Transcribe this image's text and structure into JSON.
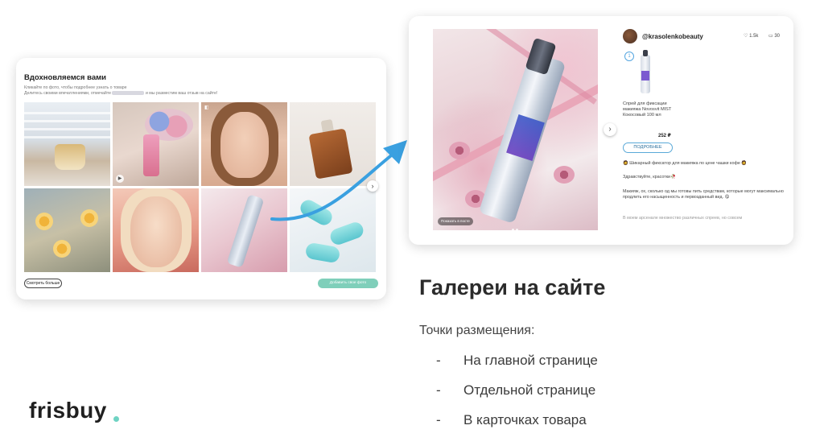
{
  "gallery": {
    "title": "Вдохновляемся вами",
    "subtitle_line1": "Кликайте по фото, чтобы подробнее узнать о товаре",
    "subtitle_line2_a": "Делитесь своими впечатлениями, отмечайте",
    "subtitle_line2_b": "и мы разместим ваш отзыв на сайте!",
    "see_more_label": "Смотреть больше",
    "add_photo_label": "Добавить свое фото",
    "next_arrow": "›"
  },
  "detail": {
    "username": "@krasolenkobeauty",
    "likes": "1.5k",
    "comments": "30",
    "tag_number": "1",
    "product_name": "Спрей для фиксации макияжа Novosvit MIST Кокосовый 100 мл",
    "price": "252 ₽",
    "more_label": "ПОДРОБНЕЕ",
    "post_line1": "🧔 Шикарный фиксатор для макияжа по цене чашки кофе 🧔",
    "post_line2": "Здравствуйте, красотки🥀",
    "post_line3": "Макияж, ох, сколько од мы готовы пить средствам, которые могут максимально продлить его насыщенность и первозданный вид. 😋",
    "post_line4": "В моем арсенале множество различных спреев, но совсем",
    "photo_credit": "Показать в посте",
    "next_arrow": "›"
  },
  "slide": {
    "heading": "Галереи на сайте",
    "placement_label": "Точки размещения:",
    "bullets": [
      "На главной странице",
      "Отдельной странице",
      "В карточках товара"
    ],
    "bullet_mark": "-"
  },
  "brand": {
    "logo_text": "frisbuy",
    "accent_color": "#6fd3c3"
  },
  "colors": {
    "arrow": "#3aa0e0",
    "add_button": "#7fcfba",
    "link": "#5aa9d8"
  }
}
